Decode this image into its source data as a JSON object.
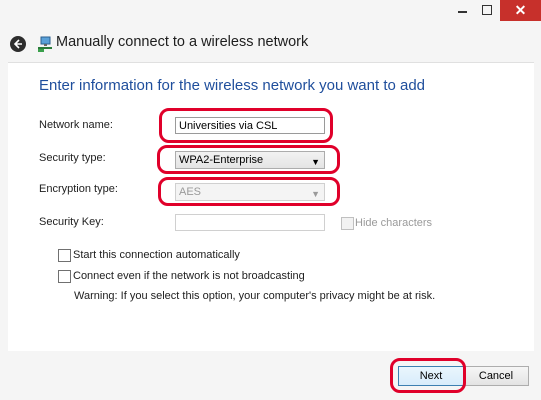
{
  "window": {
    "title": "Manually connect to a wireless network",
    "minimize_icon": "minimize-icon",
    "maximize_icon": "maximize-icon",
    "close_icon": "close-icon",
    "close_glyph": "✕"
  },
  "form": {
    "heading": "Enter information for the wireless network you want to add",
    "network_name_label": "Network name:",
    "network_name_value": "Universities via CSL",
    "security_type_label": "Security type:",
    "security_type_value": "WPA2-Enterprise",
    "encryption_type_label": "Encryption type:",
    "encryption_type_value": "AES",
    "security_key_label": "Security Key:",
    "security_key_value": "",
    "hide_characters_label": "Hide characters",
    "start_auto_label": "Start this connection automatically",
    "connect_hidden_label": "Connect even if the network is not broadcasting",
    "warning": "Warning: If you select this option, your computer's privacy might be at risk."
  },
  "buttons": {
    "next": "Next",
    "cancel": "Cancel"
  },
  "colors": {
    "heading": "#1f4e9c",
    "close_button": "#c7302b",
    "highlight": "#e0002a"
  }
}
